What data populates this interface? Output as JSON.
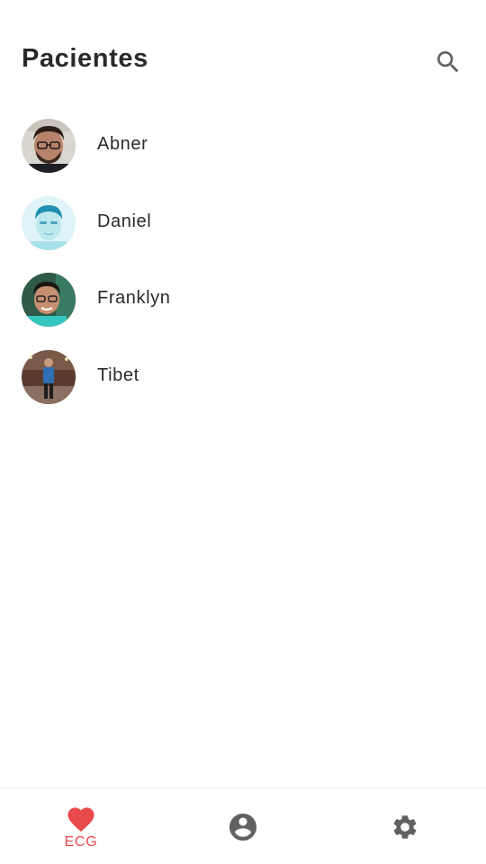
{
  "header": {
    "title": "Pacientes",
    "search_icon": "search-icon"
  },
  "patients": [
    {
      "name": "Abner"
    },
    {
      "name": "Daniel"
    },
    {
      "name": "Franklyn"
    },
    {
      "name": "Tibet"
    }
  ],
  "bottom_nav": {
    "items": [
      {
        "icon": "heart-icon",
        "label": "ECG",
        "active": true
      },
      {
        "icon": "account-circle-icon",
        "label": "",
        "active": false
      },
      {
        "icon": "gear-icon",
        "label": "",
        "active": false
      }
    ]
  },
  "colors": {
    "accent": "#e8494a",
    "icon_inactive": "#616161",
    "text": "#2a2a2a"
  }
}
